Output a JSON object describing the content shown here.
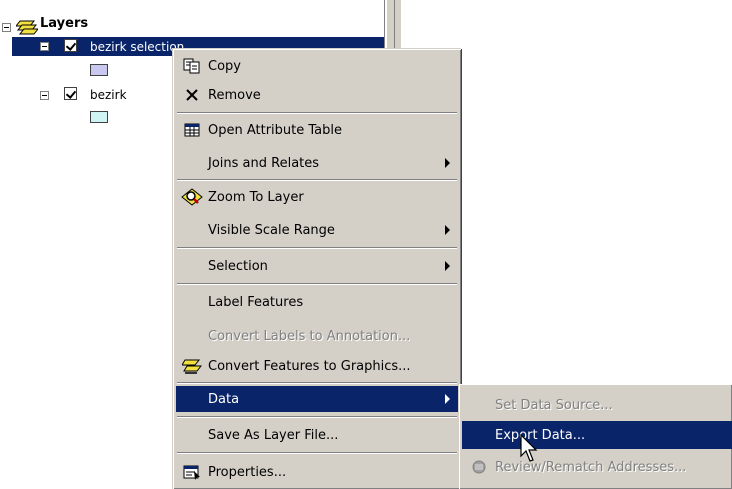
{
  "toc": {
    "root_label": "Layers",
    "layers": [
      {
        "name": "bezirk selection",
        "checked": true,
        "selected": true,
        "swatch_color": "#c8c8f0"
      },
      {
        "name": "bezirk",
        "checked": true,
        "selected": false,
        "swatch_color": "#d0f4f4"
      }
    ]
  },
  "context_menu": {
    "items": [
      {
        "label": "Copy",
        "icon": "copy-icon"
      },
      {
        "label": "Remove",
        "icon": "remove-icon"
      },
      {
        "label": "Open Attribute Table",
        "icon": "table-icon"
      },
      {
        "label": "Joins and Relates",
        "submenu": true
      },
      {
        "label": "Zoom To Layer",
        "icon": "zoom-to-layer-icon"
      },
      {
        "label": "Visible Scale Range",
        "submenu": true
      },
      {
        "label": "Selection",
        "submenu": true
      },
      {
        "label": "Label Features"
      },
      {
        "label": "Convert Labels to Annotation...",
        "disabled": true
      },
      {
        "label": "Convert Features to Graphics...",
        "icon": "convert-graphics-icon"
      },
      {
        "label": "Data",
        "submenu": true,
        "highlighted": true
      },
      {
        "label": "Save As Layer File..."
      },
      {
        "label": "Properties...",
        "icon": "properties-icon"
      }
    ]
  },
  "data_submenu": {
    "items": [
      {
        "label": "Set Data Source...",
        "disabled": true
      },
      {
        "label": "Export Data...",
        "highlighted": true
      },
      {
        "label": "Review/Rematch Addresses...",
        "disabled": true,
        "icon": "geocode-icon"
      }
    ]
  },
  "colors": {
    "selection_blue": "#0a246a",
    "menu_face": "#d4d0c8"
  }
}
